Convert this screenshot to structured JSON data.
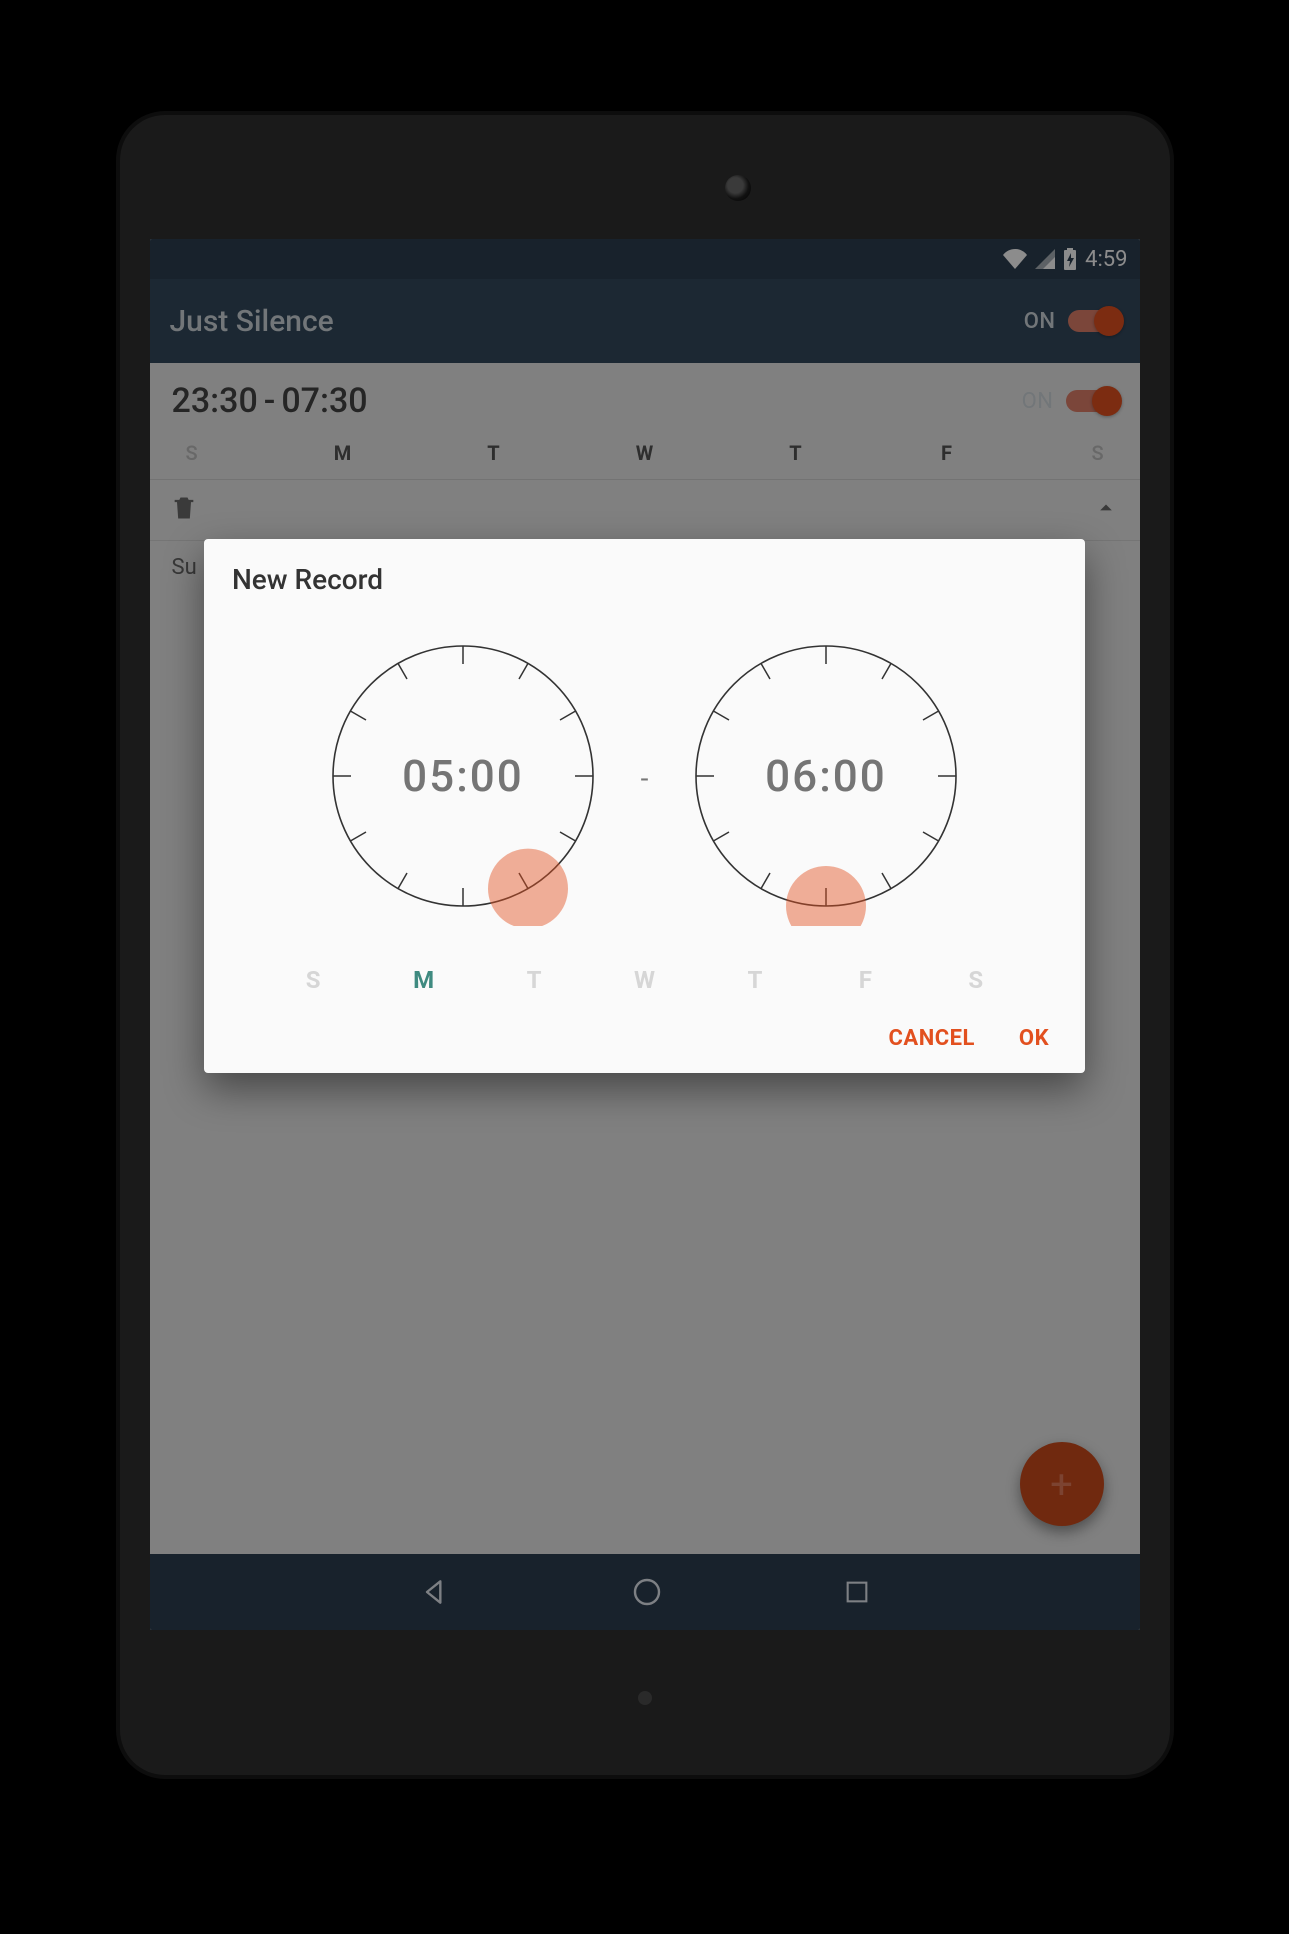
{
  "status_bar": {
    "time": "4:59"
  },
  "app_bar": {
    "title": "Just Silence",
    "toggle_label": "ON"
  },
  "record": {
    "start": "23:30",
    "end": "07:30",
    "toggle_label": "ON",
    "days": [
      "S",
      "M",
      "T",
      "W",
      "T",
      "F",
      "S"
    ],
    "days_active": [
      false,
      true,
      true,
      true,
      true,
      true,
      false
    ]
  },
  "record2": {
    "subtitle": "Su"
  },
  "dialog": {
    "title": "New Record",
    "separator": "-",
    "start": {
      "hh": "05",
      "mm": "00"
    },
    "end": {
      "hh": "06",
      "mm": "00"
    },
    "days": [
      "S",
      "M",
      "T",
      "W",
      "T",
      "F",
      "S"
    ],
    "days_active": [
      false,
      true,
      false,
      false,
      false,
      false,
      false
    ],
    "cancel_label": "CANCEL",
    "ok_label": "OK",
    "start_angle_deg": 150,
    "end_angle_deg": 180
  },
  "colors": {
    "accent": "#e2501f",
    "appbar": "#34495e"
  }
}
